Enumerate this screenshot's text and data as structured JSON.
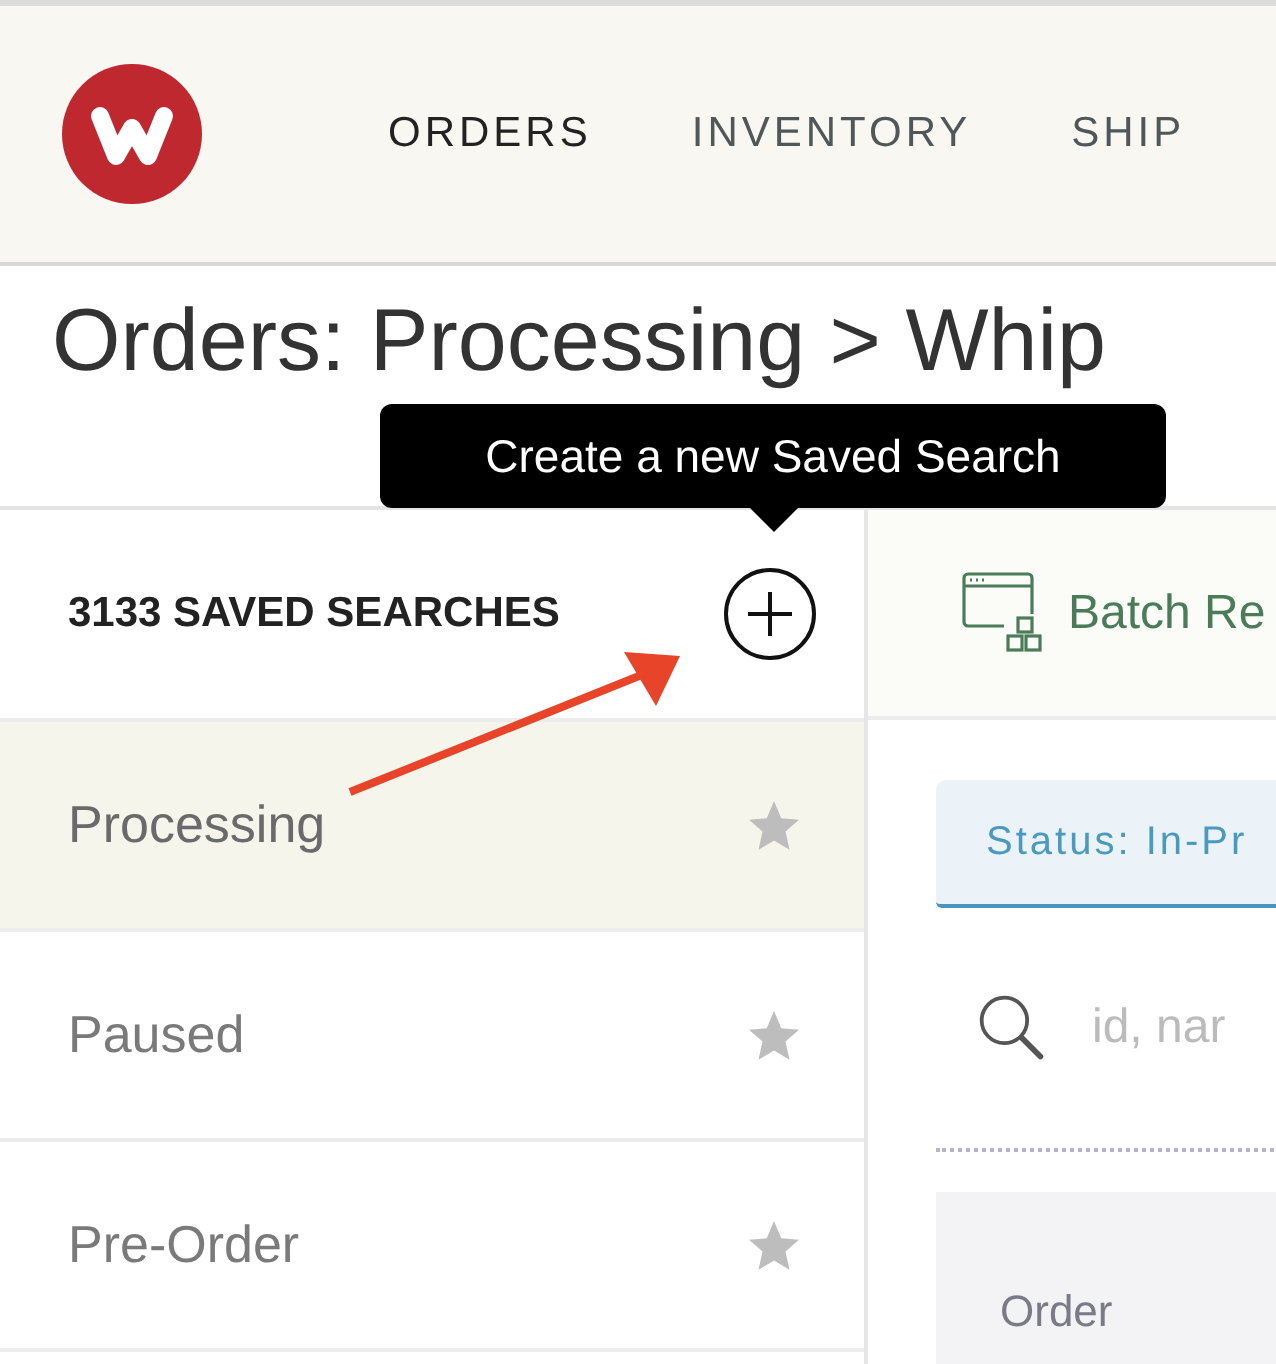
{
  "nav": {
    "items": [
      {
        "label": "ORDERS",
        "selected": true
      },
      {
        "label": "INVENTORY",
        "selected": false
      },
      {
        "label": "SHIP",
        "selected": false
      }
    ]
  },
  "page_title": "Orders: Processing > Whip",
  "tooltip": "Create a new Saved Search",
  "sidebar": {
    "heading": "3133 SAVED SEARCHES",
    "items": [
      {
        "label": "Processing",
        "selected": true
      },
      {
        "label": "Paused",
        "selected": false
      },
      {
        "label": "Pre-Order",
        "selected": false
      }
    ]
  },
  "toolbar": {
    "button": "Batch Re"
  },
  "filter_chip": "Status: In-Pr",
  "search": {
    "placeholder": "id, nar"
  },
  "table": {
    "columns": [
      "Order"
    ]
  }
}
